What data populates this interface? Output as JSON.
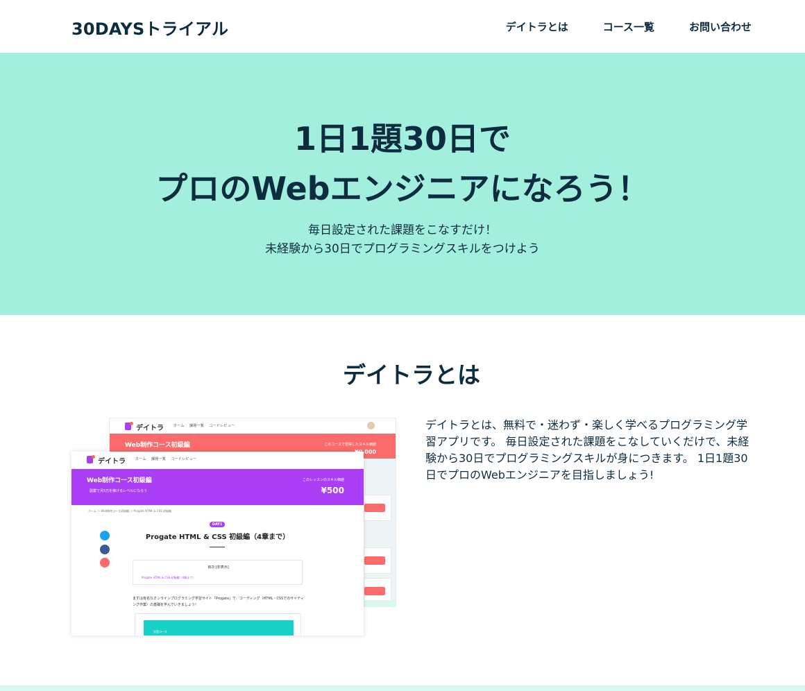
{
  "header": {
    "logo": "30DAYSトライアル",
    "nav": [
      "デイトラとは",
      "コース一覧",
      "お問い合わせ"
    ]
  },
  "hero": {
    "title_lines": [
      "1日1題30日で",
      "プロのWebエンジニアになろう！"
    ],
    "subtitle_lines": [
      "毎日設定された課題をこなすだけ！",
      "未経験から30日でプログラミングスキルをつけよう"
    ],
    "background": "#a3efde"
  },
  "about": {
    "title": "デイトラとは",
    "text": "デイトラとは、無料で・迷わず・楽しく学べるプログラミング学習アプリです。 毎日設定された課題をこなしていくだけで、未経験から30日でプログラミングスキルが身につきます。 1日1題30日でプロのWebエンジニアを目指しましょう!"
  },
  "mock_back": {
    "logo": "デイトラ",
    "nav": "ホーム　 課題一覧　 コードレビュー",
    "band_title": "Web制作コース初級編",
    "band_right": "このコースで習得したスキル価値",
    "price": "¥0,000"
  },
  "mock_front": {
    "logo": "デイトラ",
    "nav": "ホーム　 課題一覧　 コードレビュー",
    "band_title": "Web制作コース初級編",
    "band_sub": "副業で月5万を稼げるレベルになろう",
    "band_right": "このレッスンのスキル価値",
    "price": "¥500",
    "breadcrumb": "ホーム ＞ Web制作コース初級編 ＞ Progate HTML & CSS 初級編",
    "day_badge": "DAY1",
    "lesson_title": "Progate HTML & CSS 初級編（4章まで）",
    "toc_title": "目次 [非表示]",
    "toc_link": "Progate HTML & CSS 初級編（4章まで）",
    "body_text": "まずは有名なオンラインプログラミング学習サイト「Progate」で、コーディング（HTML・CSSでのサイティング作業）の基礎を学んでいきましょう！",
    "course_label": "学習コース"
  },
  "colors": {
    "navy": "#0d2c3f",
    "mint": "#a3efde",
    "coral": "#fb6b6b",
    "purple": "#a93ef5",
    "teal": "#18d2c8"
  }
}
